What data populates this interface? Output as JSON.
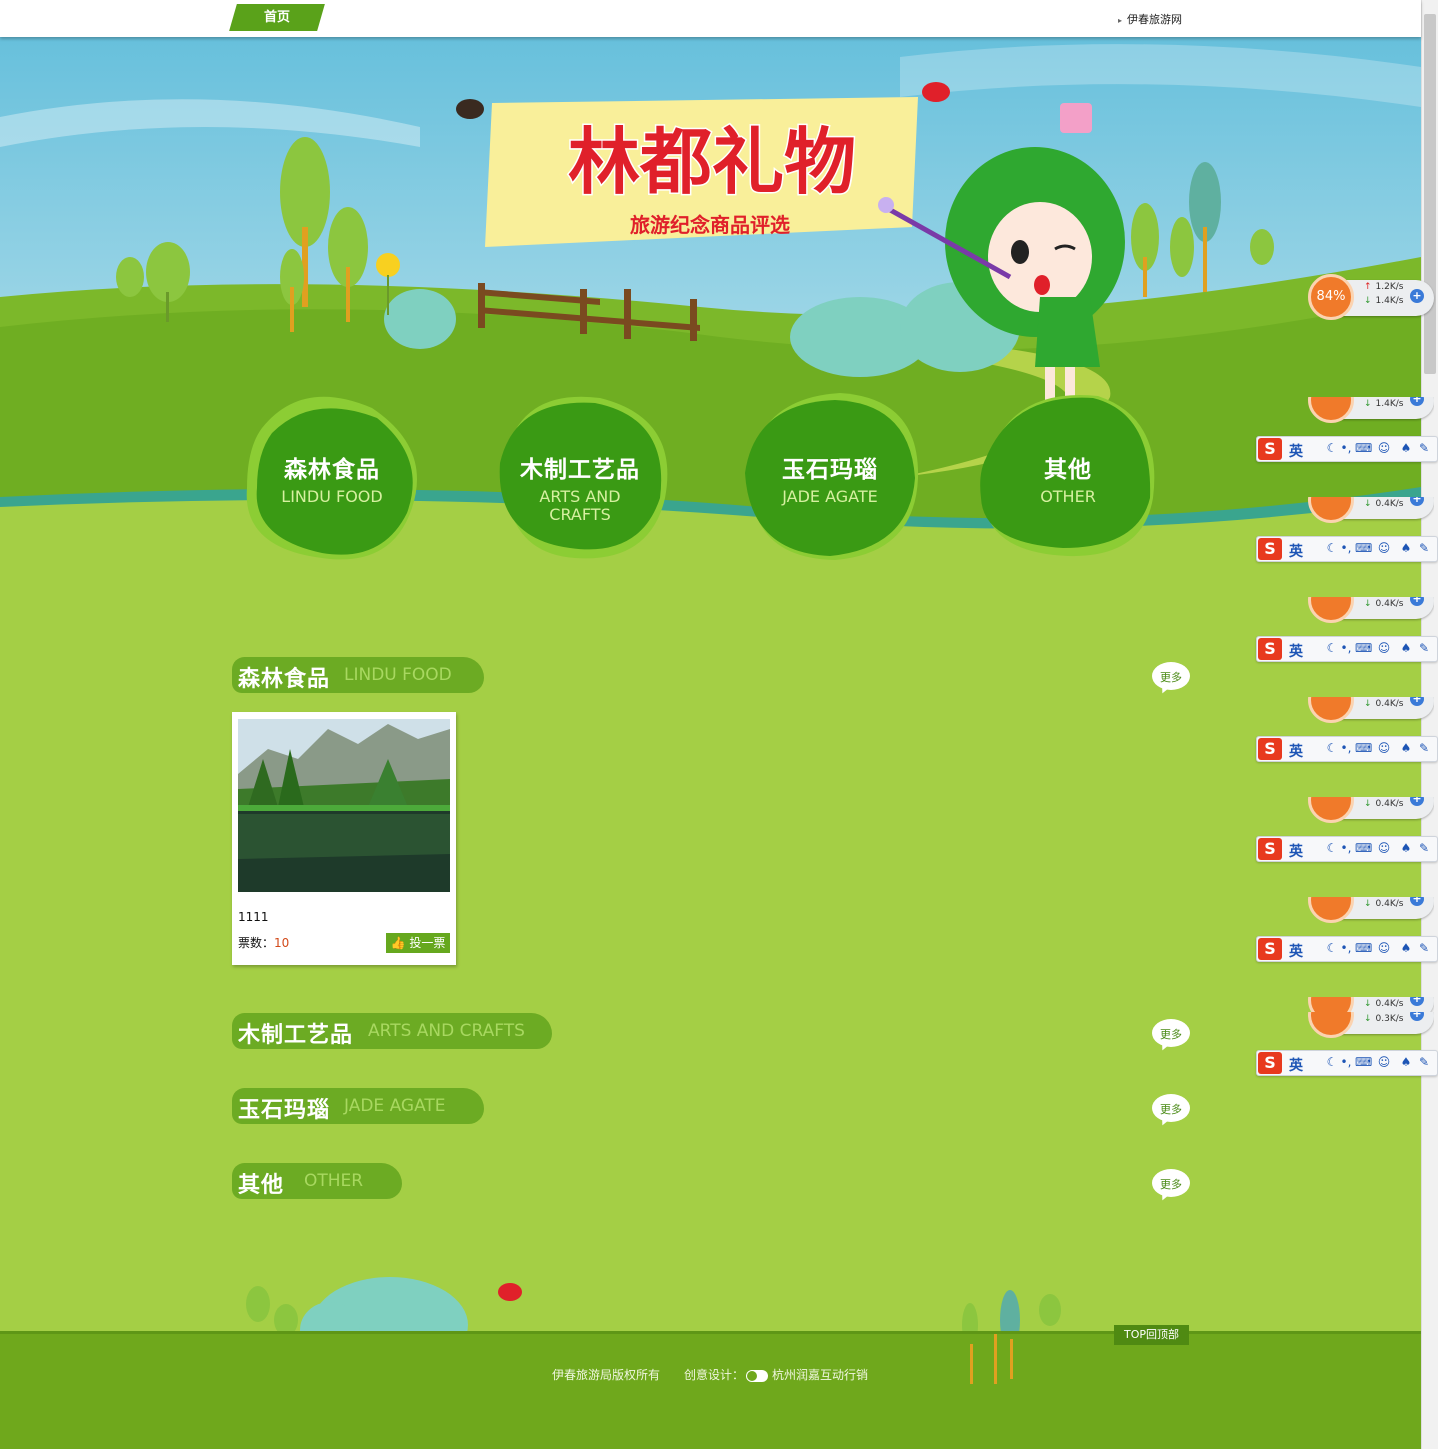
{
  "topbar": {
    "home_label": "首页",
    "site_link": "伊春旅游网"
  },
  "banner": {
    "title": "林都礼物",
    "subtitle": "旅游纪念商品评选"
  },
  "categories": [
    {
      "cn": "森林食品",
      "en": "LINDU FOOD"
    },
    {
      "cn": "木制工艺品",
      "en": "ARTS AND CRAFTS"
    },
    {
      "cn": "玉石玛瑙",
      "en": "JADE AGATE"
    },
    {
      "cn": "其他",
      "en": "OTHER"
    }
  ],
  "sections": [
    {
      "cn": "森林食品",
      "en": "LINDU FOOD",
      "more": "更多"
    },
    {
      "cn": "木制工艺品",
      "en": "ARTS AND CRAFTS",
      "more": "更多"
    },
    {
      "cn": "玉石玛瑙",
      "en": "JADE AGATE",
      "more": "更多"
    },
    {
      "cn": "其他",
      "en": "OTHER",
      "more": "更多"
    }
  ],
  "product": {
    "name": "1111",
    "votes_label": "票数：",
    "votes_value": "10",
    "vote_button": "投一票"
  },
  "footer": {
    "copyright": "伊春旅游局版权所有",
    "design_label": "创意设计：",
    "design_company": "杭州润嘉互动行销",
    "top_button": "TOP回顶部"
  },
  "overlay": {
    "speed_percent": "84%",
    "speed_up": "1.2K/s",
    "speed_down": "1.4K/s",
    "ime_label": "英",
    "ime_logo": "S",
    "stacked_speeds": [
      "1.4K/s",
      "0.4K/s",
      "0.4K/s",
      "0.4K/s",
      "0.4K/s",
      "0.4K/s",
      "0.4K/s",
      "0.3K/s"
    ]
  },
  "colors": {
    "page_green": "#a4cf45",
    "dark_green": "#3a9a14",
    "footer_green": "#6fa81c",
    "banner_red": "#e0202a",
    "accent_orange": "#f07a2a"
  }
}
